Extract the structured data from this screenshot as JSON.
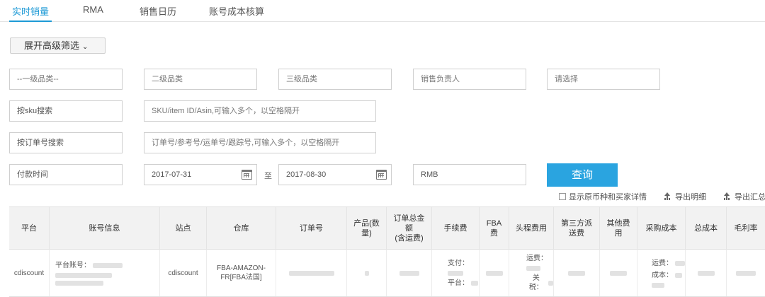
{
  "tabs": [
    {
      "label": "实时销量",
      "active": true
    },
    {
      "label": "RMA",
      "active": false
    },
    {
      "label": "销售日历",
      "active": false
    },
    {
      "label": "账号成本核算",
      "active": false
    }
  ],
  "accent_color": "#1e9ad6",
  "filter_toggle": {
    "label": "展开高级筛选",
    "icon": "chevron-down-icon"
  },
  "filters": {
    "category1": "--一级品类--",
    "category2": "二级品类",
    "category3": "三级品类",
    "sales_owner": "销售负责人",
    "select": "请选择",
    "sku_label": "按sku搜索",
    "sku_placeholder": "SKU/item ID/Asin,可输入多个，以空格隔开",
    "order_label": "按订单号搜索",
    "order_placeholder": "订单号/参考号/运单号/跟踪号,可输入多个，以空格隔开",
    "pay_time_label": "付款时间",
    "date_from": "2017-07-31",
    "date_to_label": "至",
    "date_to": "2017-08-30",
    "currency": "RMB"
  },
  "query_button": "查询",
  "options": {
    "show_detail": "显示原币种和买家详情",
    "export_detail": "导出明细",
    "export_summary": "导出汇总"
  },
  "table": {
    "headers": [
      "平台",
      "账号信息",
      "站点",
      "仓库",
      "订单号",
      "产品(数量)",
      "订单总金额(含运费)",
      "手续费",
      "FBA费",
      "头程费用",
      "第三方派送费",
      "其他费用",
      "采购成本",
      "总成本",
      "毛利率"
    ],
    "header_display": {
      "product_qty": [
        "产品(数",
        "量)"
      ],
      "order_total": [
        "订单总金",
        "额",
        "(含运费)"
      ],
      "fba_fee": [
        "FBA",
        "费"
      ],
      "third_party": [
        "第三方派",
        "送费"
      ],
      "other_fee": [
        "其他费",
        "用"
      ]
    },
    "rows": [
      {
        "platform": "cdiscount",
        "account_label": "平台账号：",
        "site": "cdiscount",
        "warehouse_line1": "FBA-AMAZON-",
        "warehouse_line2": "FR[FBA法国]",
        "fee_pay_label": "支付：",
        "fee_platform_label": "平台：",
        "first_leg_shipping_label": "运费：",
        "first_leg_tax_label": "关税：",
        "purchase_shipping_label": "运费：",
        "purchase_cost_label": "成本："
      }
    ]
  }
}
